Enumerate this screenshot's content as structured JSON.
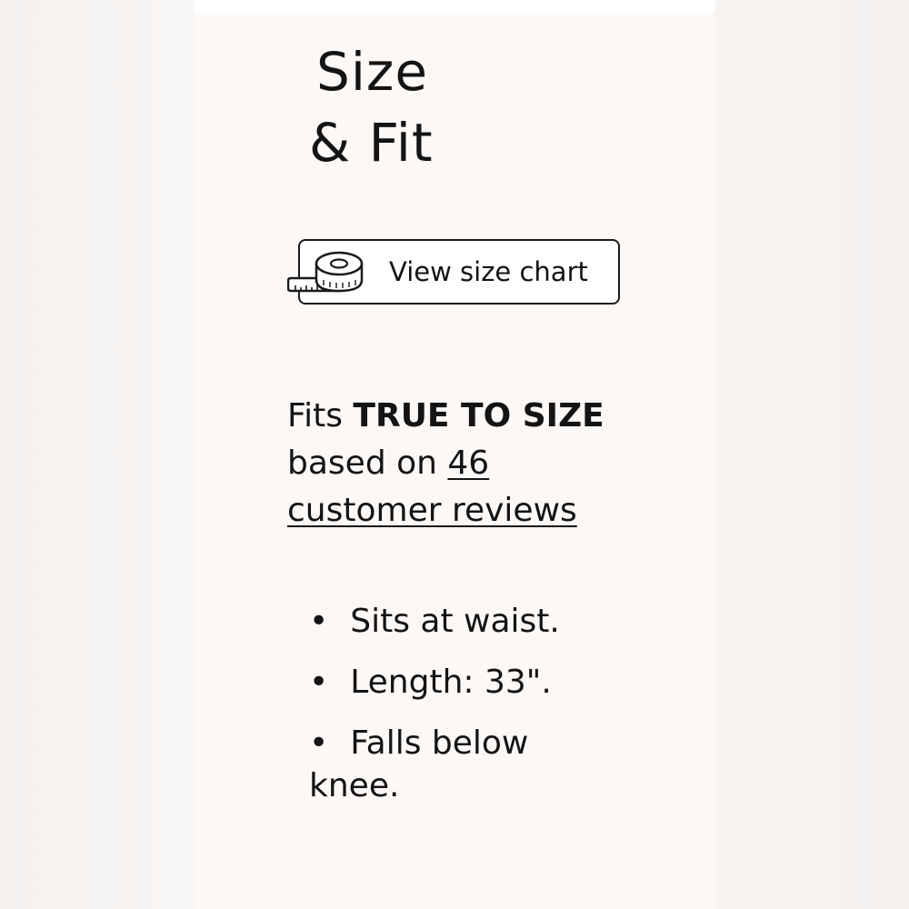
{
  "section": {
    "title_line1": "Size",
    "title_line2": "& Fit"
  },
  "size_chart_button": {
    "label": "View size chart",
    "icon": "measuring-tape-icon"
  },
  "fit_summary": {
    "prefix": "Fits",
    "fit_value": "TRUE TO SIZE",
    "based_on": "based on",
    "review_count": "46",
    "reviews_label": "customer reviews"
  },
  "details": [
    "Sits at waist.",
    "Length: 33\".",
    "Falls below knee."
  ],
  "colors": {
    "panel_background": "#fcf8f6",
    "text": "#141414",
    "button_border": "#1a1a1a"
  }
}
